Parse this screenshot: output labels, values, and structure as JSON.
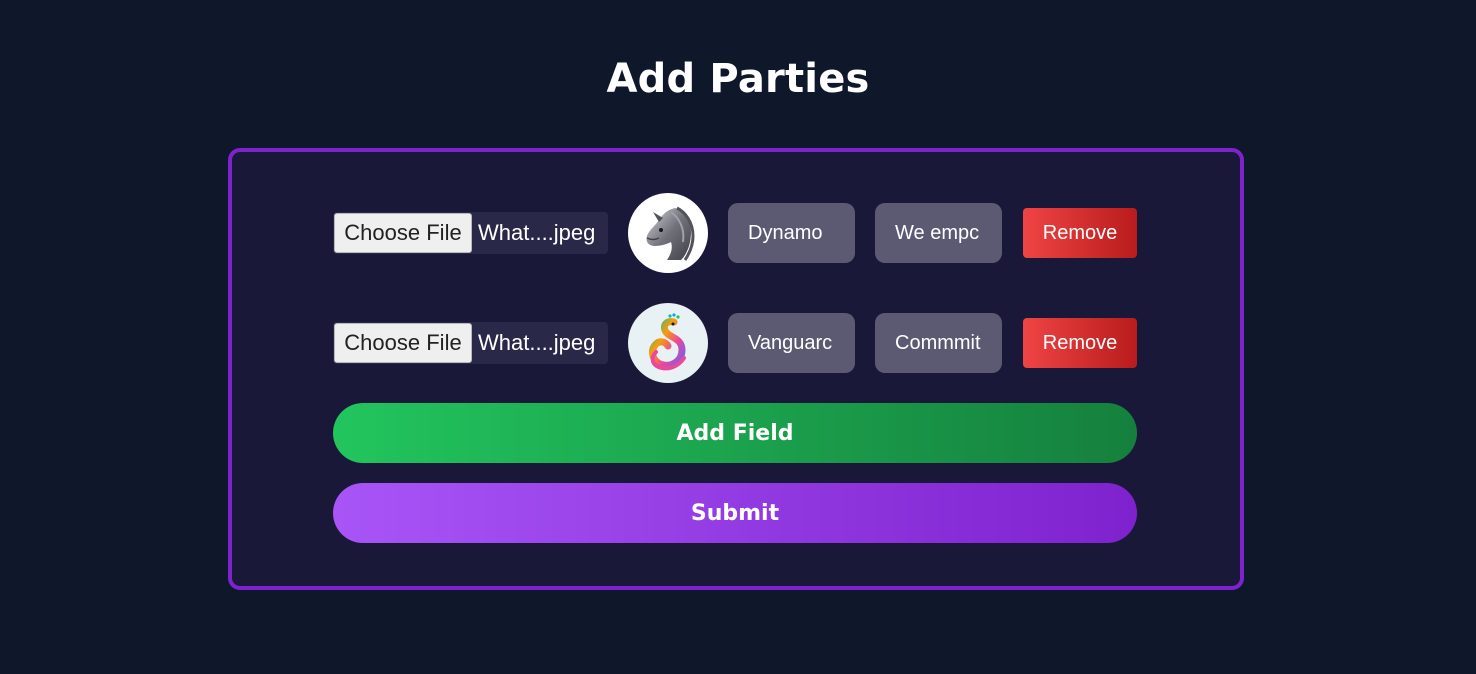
{
  "page": {
    "title": "Add Parties"
  },
  "colors": {
    "background": "#0f172a",
    "card_background": "#1a1838",
    "card_border": "#7e22ce",
    "remove_button": "#dc2626",
    "add_field_button": "#16a34a",
    "submit_button": "#9333ea",
    "text_field": "#5c5a73"
  },
  "parties": [
    {
      "file_button_label": "Choose File",
      "file_name": "What....jpeg",
      "logo_icon": "horse-head-logo-icon",
      "name_value": "Dynamo",
      "description_value": "We empc",
      "remove_label": "Remove"
    },
    {
      "file_button_label": "Choose File",
      "file_name": "What....jpeg",
      "logo_icon": "peacock-logo-icon",
      "name_value": "Vanguarc",
      "description_value": "Commmit",
      "remove_label": "Remove"
    }
  ],
  "actions": {
    "add_field_label": "Add Field",
    "submit_label": "Submit"
  }
}
